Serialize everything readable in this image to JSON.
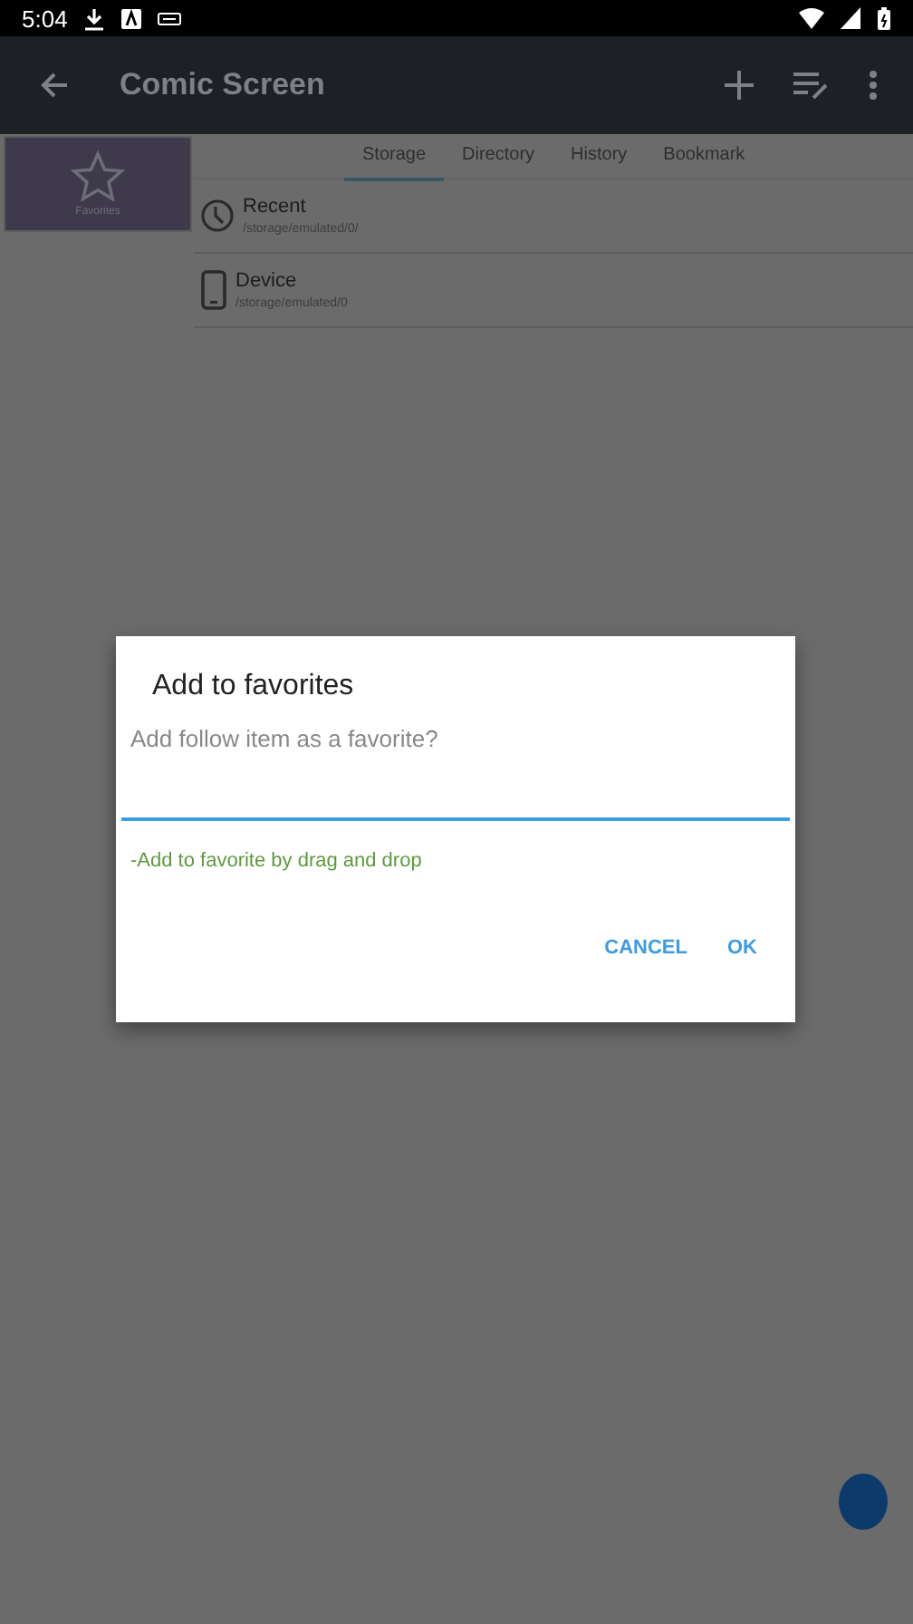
{
  "status_bar": {
    "time": "5:04"
  },
  "app_bar": {
    "title": "Comic Screen"
  },
  "sidebar": {
    "items": [
      {
        "label": "Favorites",
        "selected": true
      }
    ]
  },
  "tabs": [
    {
      "label": "Storage",
      "selected": true
    },
    {
      "label": "Directory",
      "selected": false
    },
    {
      "label": "History",
      "selected": false
    },
    {
      "label": "Bookmark",
      "selected": false
    }
  ],
  "locations": [
    {
      "kind": "clock",
      "name": "Recent",
      "path": "/storage/emulated/0/"
    },
    {
      "kind": "phone",
      "name": "Device",
      "path": "/storage/emulated/0"
    }
  ],
  "dialog": {
    "title": "Add to favorites",
    "message": "Add follow item as a favorite?",
    "hint": "-Add to favorite by drag and drop",
    "buttons": [
      "CANCEL",
      "OK"
    ]
  }
}
